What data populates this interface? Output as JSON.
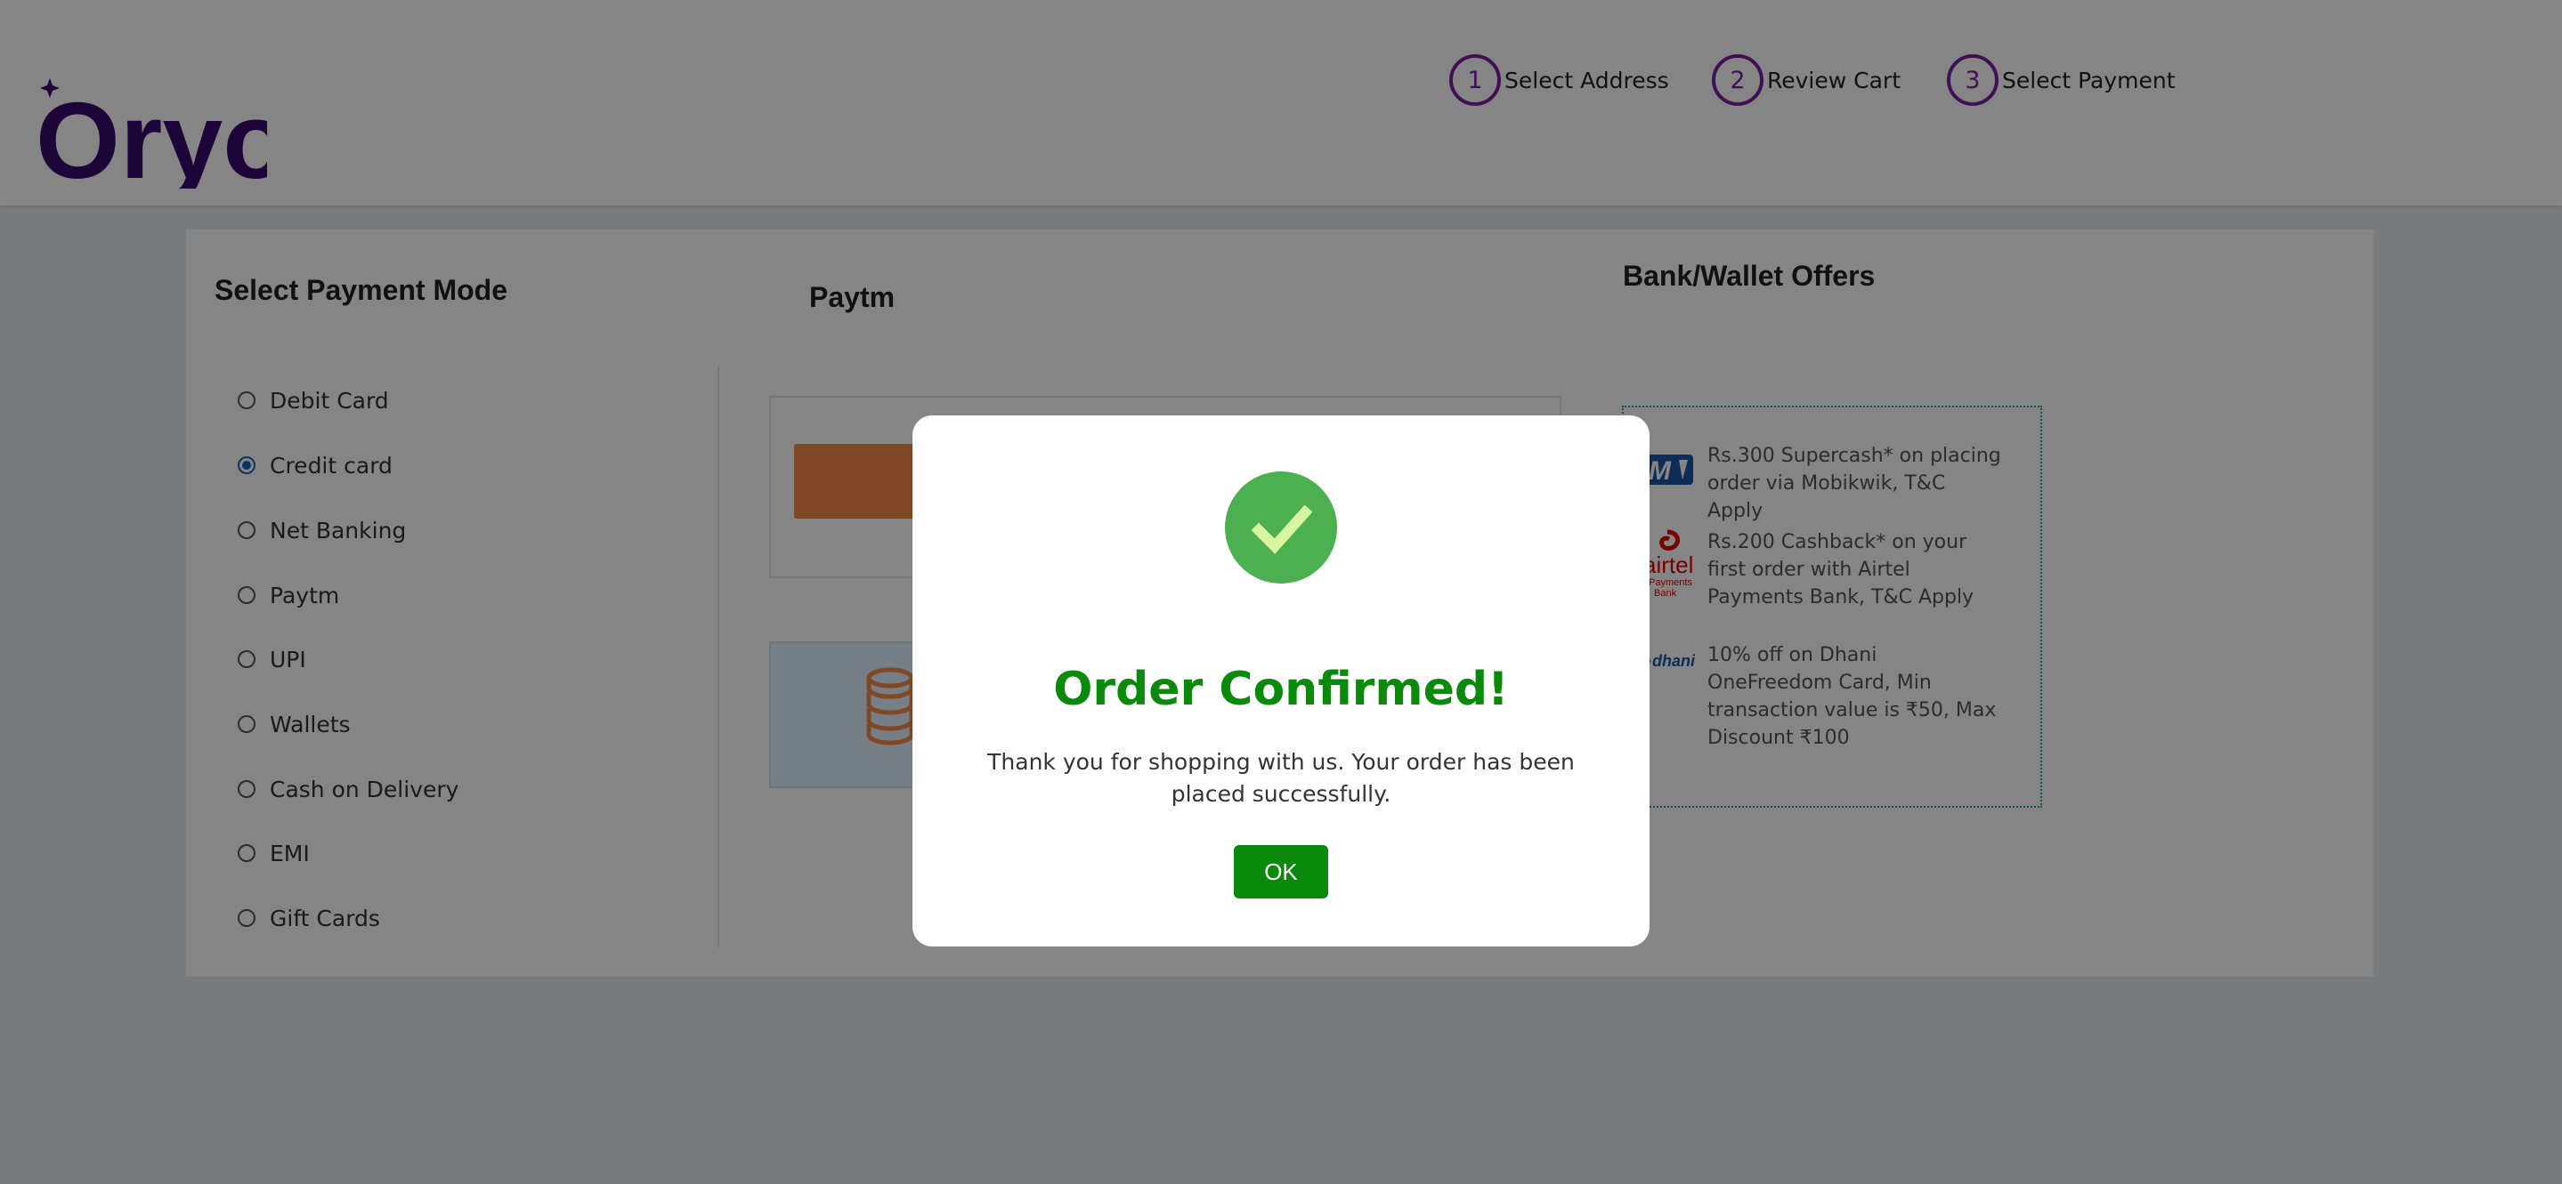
{
  "brand": {
    "name": "Oryo",
    "color": "#3a0a6e"
  },
  "steps": [
    {
      "num": "1",
      "label": "Select Address"
    },
    {
      "num": "2",
      "label": "Review Cart"
    },
    {
      "num": "3",
      "label": "Select Payment"
    }
  ],
  "payment": {
    "heading": "Select Payment Mode",
    "selected": "Credit card",
    "options": [
      "Debit Card",
      "Credit card",
      "Net Banking",
      "Paytm",
      "UPI",
      "Wallets",
      "Cash on Delivery",
      "EMI",
      "Gift Cards"
    ]
  },
  "paytm": {
    "heading": "Paytm",
    "button_icon": "paytm-button",
    "coins_icon": "coins-icon"
  },
  "offers": {
    "heading": "Bank/Wallet Offers",
    "items": [
      {
        "icon": "mobikwik-logo",
        "text": "Rs.300 Supercash* on placing order via Mobikwik, T&C Apply"
      },
      {
        "icon": "airtel-payments-bank-logo",
        "text": "Rs.200 Cashback* on your first order with Airtel Payments Bank, T&C Apply"
      },
      {
        "icon": "dhani-logo",
        "text": "10% off on Dhani OneFreedom Card, Min transaction value is ₹50, Max Discount ₹100"
      }
    ]
  },
  "modal": {
    "icon": "check-icon",
    "title": "Order Confirmed!",
    "message": "Thank you for shopping with us. Your order has been placed successfully.",
    "ok_label": "OK"
  },
  "colors": {
    "accent": "#7b1fa2",
    "success": "#0a8a0a",
    "radio": "#1565c0"
  }
}
